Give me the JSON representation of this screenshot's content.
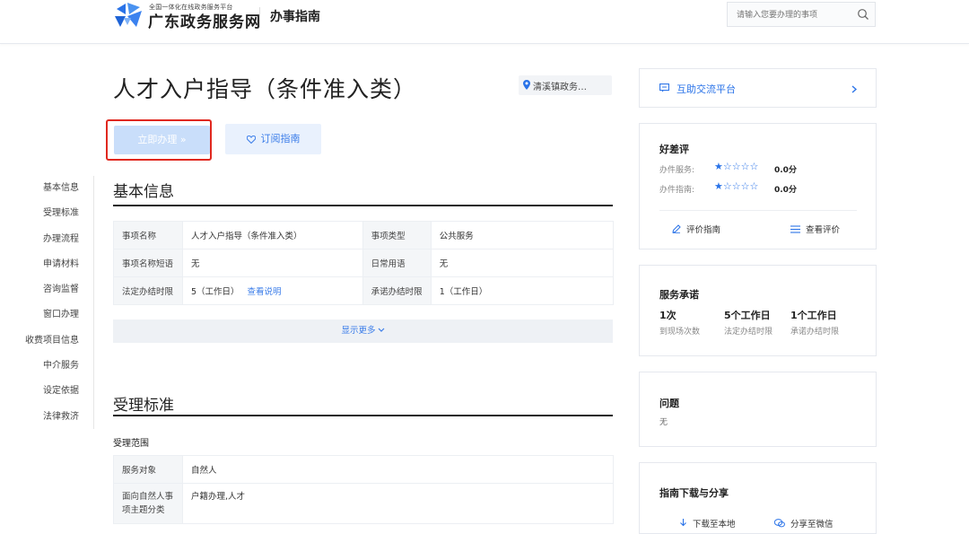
{
  "header": {
    "logo_subtitle": "全国一体化在线政务服务平台",
    "logo_title": "广东政务服务网",
    "guide_label": "办事指南",
    "search_placeholder": "请输入您要办理的事项"
  },
  "page": {
    "title": "人才入户指导（条件准入类）",
    "location": "清溪镇政务…",
    "apply_button": "立即办理 »",
    "subscribe_button": "订阅指南"
  },
  "left_nav": [
    "基本信息",
    "受理标准",
    "办理流程",
    "申请材料",
    "咨询监督",
    "窗口办理",
    "收费项目信息",
    "中介服务",
    "设定依据",
    "法律救济"
  ],
  "basic_info": {
    "title": "基本信息",
    "rows": [
      {
        "k1": "事项名称",
        "v1": "人才入户指导（条件准入类）",
        "k2": "事项类型",
        "v2": "公共服务"
      },
      {
        "k1": "事项名称短语",
        "v1": "无",
        "k2": "日常用语",
        "v2": "无"
      },
      {
        "k1": "法定办结时限",
        "v1": "5（工作日）",
        "k2": "承诺办结时限",
        "v2": "1（工作日）"
      }
    ],
    "view_explain": "查看说明",
    "show_more": "显示更多"
  },
  "acceptance": {
    "title": "受理标准",
    "scope_label": "受理范围",
    "rows": [
      {
        "k": "服务对象",
        "v": "自然人"
      },
      {
        "k": "面向自然人事项主题分类",
        "v": "户籍办理,人才"
      }
    ]
  },
  "sidebar": {
    "platform": "互助交流平台",
    "rating": {
      "title": "好差评",
      "service_label": "办件服务:",
      "guide_label": "办件指南:",
      "service_score": "0.0分",
      "guide_score": "0.0分",
      "stars": "★☆☆☆☆",
      "rate_guide": "评价指南",
      "view_reviews": "查看评价"
    },
    "promise": {
      "title": "服务承诺",
      "items": [
        {
          "value": "1次",
          "label": "到现场次数"
        },
        {
          "value": "5个工作日",
          "label": "法定办结时限"
        },
        {
          "value": "1个工作日",
          "label": "承诺办结时限"
        }
      ]
    },
    "question": {
      "title": "问题",
      "value": "无"
    },
    "download": {
      "title": "指南下载与分享",
      "download_local": "下载至本地",
      "share_wechat": "分享至微信"
    }
  },
  "colors": {
    "accent": "#3b7de9",
    "highlight": "#e0281f",
    "apply_bg": "#c9defa"
  }
}
